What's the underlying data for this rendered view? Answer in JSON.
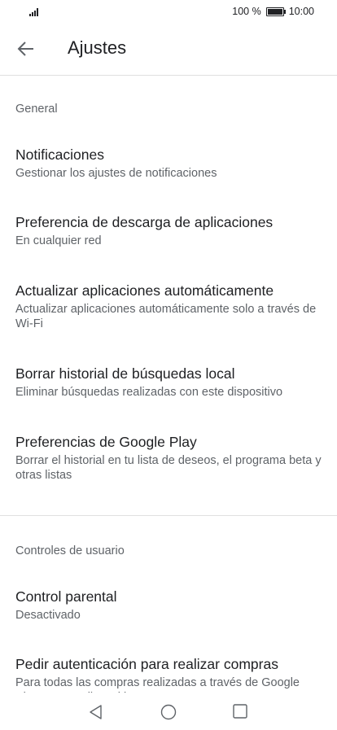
{
  "status_bar": {
    "battery_label": "100 %",
    "battery_level": 1.0,
    "time": "10:00"
  },
  "app_bar": {
    "title": "Ajustes"
  },
  "sections": [
    {
      "header": "General",
      "items": [
        {
          "title": "Notificaciones",
          "subtitle": "Gestionar los ajustes de notificaciones"
        },
        {
          "title": "Preferencia de descarga de aplicaciones",
          "subtitle": "En cualquier red"
        },
        {
          "title": "Actualizar aplicaciones automáticamente",
          "subtitle": "Actualizar aplicaciones automáticamente solo a través de Wi-Fi"
        },
        {
          "title": "Borrar historial de búsquedas local",
          "subtitle": "Eliminar búsquedas realizadas con este dispositivo"
        },
        {
          "title": "Preferencias de Google Play",
          "subtitle": "Borrar el historial en tu lista de deseos, el programa beta y otras listas"
        }
      ]
    },
    {
      "header": "Controles de usuario",
      "items": [
        {
          "title": "Control parental",
          "subtitle": "Desactivado"
        },
        {
          "title": "Pedir autenticación para realizar compras",
          "subtitle": "Para todas las compras realizadas a través de Google Play en este dispositivo"
        }
      ]
    }
  ]
}
